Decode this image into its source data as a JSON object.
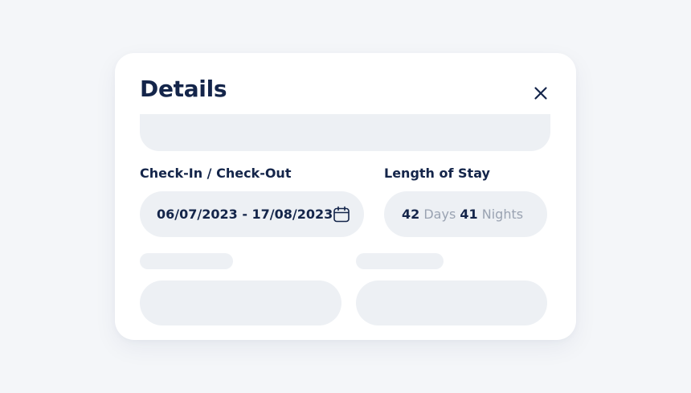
{
  "modal": {
    "title": "Details"
  },
  "dates": {
    "label": "Check-In / Check-Out",
    "value": "06/07/2023 - 17/08/2023",
    "icon": "calendar-icon"
  },
  "stay": {
    "label": "Length of Stay",
    "days_count": "42",
    "days_unit": "Days",
    "nights_count": "41",
    "nights_unit": "Nights"
  },
  "icons": {
    "close": "close-icon"
  },
  "colors": {
    "background": "#f4f6f9",
    "card": "#ffffff",
    "field": "#edf0f4",
    "text_primary": "#14254a",
    "text_muted": "#9aa3b2"
  }
}
